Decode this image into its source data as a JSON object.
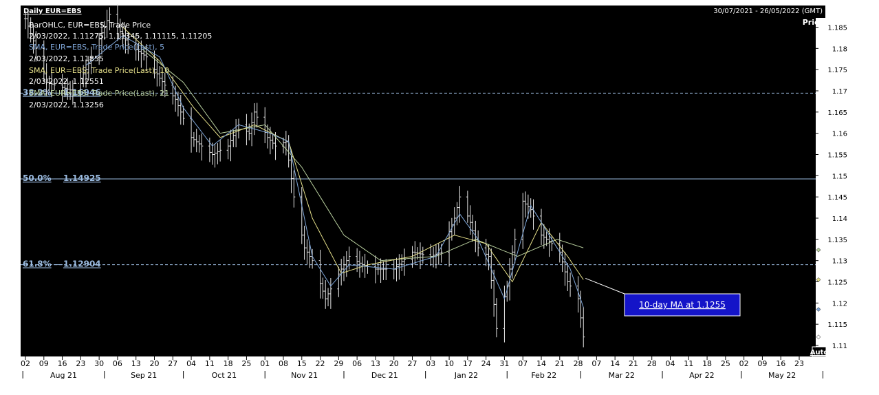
{
  "header": {
    "title": "Daily EUR=EBS",
    "date_range": "30/07/2021 - 26/05/2022 (GMT)"
  },
  "legend": {
    "bar_name": "BarOHLC, EUR=EBS, Trade Price",
    "bar_values": "2/03/2022, 1.11275, 1.11345, 1.11115, 1.11205",
    "sma5_name": "SMA, EUR=EBS, Trade Price(Last),  5",
    "sma5_value": "2/03/2022, 1.11855",
    "sma10_name": "SMA, EUR=EBS, Trade Price(Last),  10",
    "sma10_value": "2/03/2022, 1.12551",
    "sma21_name": "SMA, EUR=EBS, Trade Price(Last),  21",
    "sma21_value": "2/03/2022, 1.13256"
  },
  "fib_levels": [
    {
      "pct": "38.2%",
      "value_label": "1.16946",
      "value": 1.16946,
      "style": "dashed"
    },
    {
      "pct": "50.0%",
      "value_label": "1.14925",
      "value": 1.14925,
      "style": "solid"
    },
    {
      "pct": "61.8%",
      "value_label": "1.12904",
      "value": 1.12904,
      "style": "dashed"
    }
  ],
  "annotation": {
    "text": "10-day MA at 1.1255",
    "value": 1.1255
  },
  "axis": {
    "y_title": "Price",
    "auto_label": "Auto"
  },
  "colors": {
    "background": "#000000",
    "bars": "#e8e8e8",
    "sma5": "#7fa6d8",
    "sma10": "#e6e08a",
    "sma21": "#b8cf9e",
    "fib": "#9bbbe0",
    "annotation_bg": "#1414c8",
    "axis_bg": "#ffffff"
  },
  "chart_data": {
    "type": "line",
    "title": "Daily EUR=EBS",
    "ylabel": "Price",
    "ylim": [
      1.106,
      1.19
    ],
    "x_range": [
      "2021-07-30",
      "2022-05-26"
    ],
    "y_ticks": [
      "1.185",
      "1.18",
      "1.175",
      "1.17",
      "1.165",
      "1.16",
      "1.155",
      "1.15",
      "1.145",
      "1.14",
      "1.135",
      "1.13",
      "1.125",
      "1.12",
      "1.115",
      "1.11"
    ],
    "x_day_ticks": [
      "02",
      "09",
      "16",
      "23",
      "30",
      "06",
      "13",
      "20",
      "27",
      "04",
      "11",
      "18",
      "25",
      "01",
      "08",
      "15",
      "22",
      "29",
      "06",
      "13",
      "20",
      "27",
      "03",
      "10",
      "17",
      "24",
      "31",
      "07",
      "14",
      "21",
      "28",
      "07",
      "14",
      "21",
      "28",
      "04",
      "11",
      "18",
      "25",
      "02",
      "09",
      "16",
      "23"
    ],
    "x_month_labels": [
      "Aug 21",
      "Sep 21",
      "Oct 21",
      "Nov 21",
      "Dec 21",
      "Jan 22",
      "Feb 22",
      "Mar 22",
      "Apr 22",
      "May 22"
    ],
    "close_anchors": [
      {
        "x": "2021-08-02",
        "y": 1.187
      },
      {
        "x": "2021-08-06",
        "y": 1.18
      },
      {
        "x": "2021-08-10",
        "y": 1.172
      },
      {
        "x": "2021-08-20",
        "y": 1.17
      },
      {
        "x": "2021-08-25",
        "y": 1.175
      },
      {
        "x": "2021-09-03",
        "y": 1.188
      },
      {
        "x": "2021-09-10",
        "y": 1.181
      },
      {
        "x": "2021-09-17",
        "y": 1.178
      },
      {
        "x": "2021-09-22",
        "y": 1.173
      },
      {
        "x": "2021-09-28",
        "y": 1.168
      },
      {
        "x": "2021-10-04",
        "y": 1.159
      },
      {
        "x": "2021-10-12",
        "y": 1.155
      },
      {
        "x": "2021-10-18",
        "y": 1.157
      },
      {
        "x": "2021-10-22",
        "y": 1.162
      },
      {
        "x": "2021-10-26",
        "y": 1.16
      },
      {
        "x": "2021-10-28",
        "y": 1.165
      },
      {
        "x": "2021-11-02",
        "y": 1.159
      },
      {
        "x": "2021-11-05",
        "y": 1.157
      },
      {
        "x": "2021-11-09",
        "y": 1.158
      },
      {
        "x": "2021-11-12",
        "y": 1.145
      },
      {
        "x": "2021-11-16",
        "y": 1.133
      },
      {
        "x": "2021-11-19",
        "y": 1.13
      },
      {
        "x": "2021-11-24",
        "y": 1.121
      },
      {
        "x": "2021-11-30",
        "y": 1.128
      },
      {
        "x": "2021-12-03",
        "y": 1.131
      },
      {
        "x": "2021-12-08",
        "y": 1.129
      },
      {
        "x": "2021-12-13",
        "y": 1.128
      },
      {
        "x": "2021-12-20",
        "y": 1.128
      },
      {
        "x": "2021-12-27",
        "y": 1.132
      },
      {
        "x": "2022-01-03",
        "y": 1.131
      },
      {
        "x": "2022-01-07",
        "y": 1.132
      },
      {
        "x": "2022-01-12",
        "y": 1.14
      },
      {
        "x": "2022-01-14",
        "y": 1.145
      },
      {
        "x": "2022-01-18",
        "y": 1.139
      },
      {
        "x": "2022-01-21",
        "y": 1.133
      },
      {
        "x": "2022-01-25",
        "y": 1.131
      },
      {
        "x": "2022-01-28",
        "y": 1.114
      },
      {
        "x": "2022-02-01",
        "y": 1.124
      },
      {
        "x": "2022-02-03",
        "y": 1.132
      },
      {
        "x": "2022-02-07",
        "y": 1.144
      },
      {
        "x": "2022-02-10",
        "y": 1.142
      },
      {
        "x": "2022-02-14",
        "y": 1.136
      },
      {
        "x": "2022-02-18",
        "y": 1.134
      },
      {
        "x": "2022-02-21",
        "y": 1.132
      },
      {
        "x": "2022-02-24",
        "y": 1.125
      },
      {
        "x": "2022-02-28",
        "y": 1.121
      },
      {
        "x": "2022-03-02",
        "y": 1.112
      }
    ],
    "sma5_anchors": [
      {
        "x": "2021-08-25",
        "y": 1.176
      },
      {
        "x": "2021-09-08",
        "y": 1.183
      },
      {
        "x": "2021-09-22",
        "y": 1.178
      },
      {
        "x": "2021-10-01",
        "y": 1.166
      },
      {
        "x": "2021-10-12",
        "y": 1.157
      },
      {
        "x": "2021-10-22",
        "y": 1.162
      },
      {
        "x": "2021-11-03",
        "y": 1.16
      },
      {
        "x": "2021-11-10",
        "y": 1.158
      },
      {
        "x": "2021-11-19",
        "y": 1.131
      },
      {
        "x": "2021-11-26",
        "y": 1.124
      },
      {
        "x": "2021-12-03",
        "y": 1.129
      },
      {
        "x": "2021-12-20",
        "y": 1.128
      },
      {
        "x": "2022-01-05",
        "y": 1.131
      },
      {
        "x": "2022-01-14",
        "y": 1.141
      },
      {
        "x": "2022-01-21",
        "y": 1.135
      },
      {
        "x": "2022-01-31",
        "y": 1.121
      },
      {
        "x": "2022-02-10",
        "y": 1.143
      },
      {
        "x": "2022-02-18",
        "y": 1.135
      },
      {
        "x": "2022-02-25",
        "y": 1.128
      },
      {
        "x": "2022-03-02",
        "y": 1.119
      }
    ],
    "sma10_anchors": [
      {
        "x": "2021-09-08",
        "y": 1.185
      },
      {
        "x": "2021-09-22",
        "y": 1.177
      },
      {
        "x": "2021-10-05",
        "y": 1.166
      },
      {
        "x": "2021-10-15",
        "y": 1.159
      },
      {
        "x": "2021-10-28",
        "y": 1.162
      },
      {
        "x": "2021-11-10",
        "y": 1.158
      },
      {
        "x": "2021-11-19",
        "y": 1.14
      },
      {
        "x": "2021-11-30",
        "y": 1.127
      },
      {
        "x": "2021-12-10",
        "y": 1.129
      },
      {
        "x": "2021-12-27",
        "y": 1.131
      },
      {
        "x": "2022-01-12",
        "y": 1.136
      },
      {
        "x": "2022-01-24",
        "y": 1.134
      },
      {
        "x": "2022-02-03",
        "y": 1.125
      },
      {
        "x": "2022-02-14",
        "y": 1.139
      },
      {
        "x": "2022-02-24",
        "y": 1.131
      },
      {
        "x": "2022-03-02",
        "y": 1.1255
      }
    ],
    "sma21_anchors": [
      {
        "x": "2021-09-15",
        "y": 1.18
      },
      {
        "x": "2021-10-01",
        "y": 1.172
      },
      {
        "x": "2021-10-15",
        "y": 1.16
      },
      {
        "x": "2021-11-01",
        "y": 1.162
      },
      {
        "x": "2021-11-15",
        "y": 1.152
      },
      {
        "x": "2021-12-01",
        "y": 1.136
      },
      {
        "x": "2021-12-15",
        "y": 1.13
      },
      {
        "x": "2022-01-05",
        "y": 1.131
      },
      {
        "x": "2022-01-20",
        "y": 1.135
      },
      {
        "x": "2022-02-05",
        "y": 1.131
      },
      {
        "x": "2022-02-20",
        "y": 1.135
      },
      {
        "x": "2022-03-02",
        "y": 1.133
      }
    ]
  }
}
